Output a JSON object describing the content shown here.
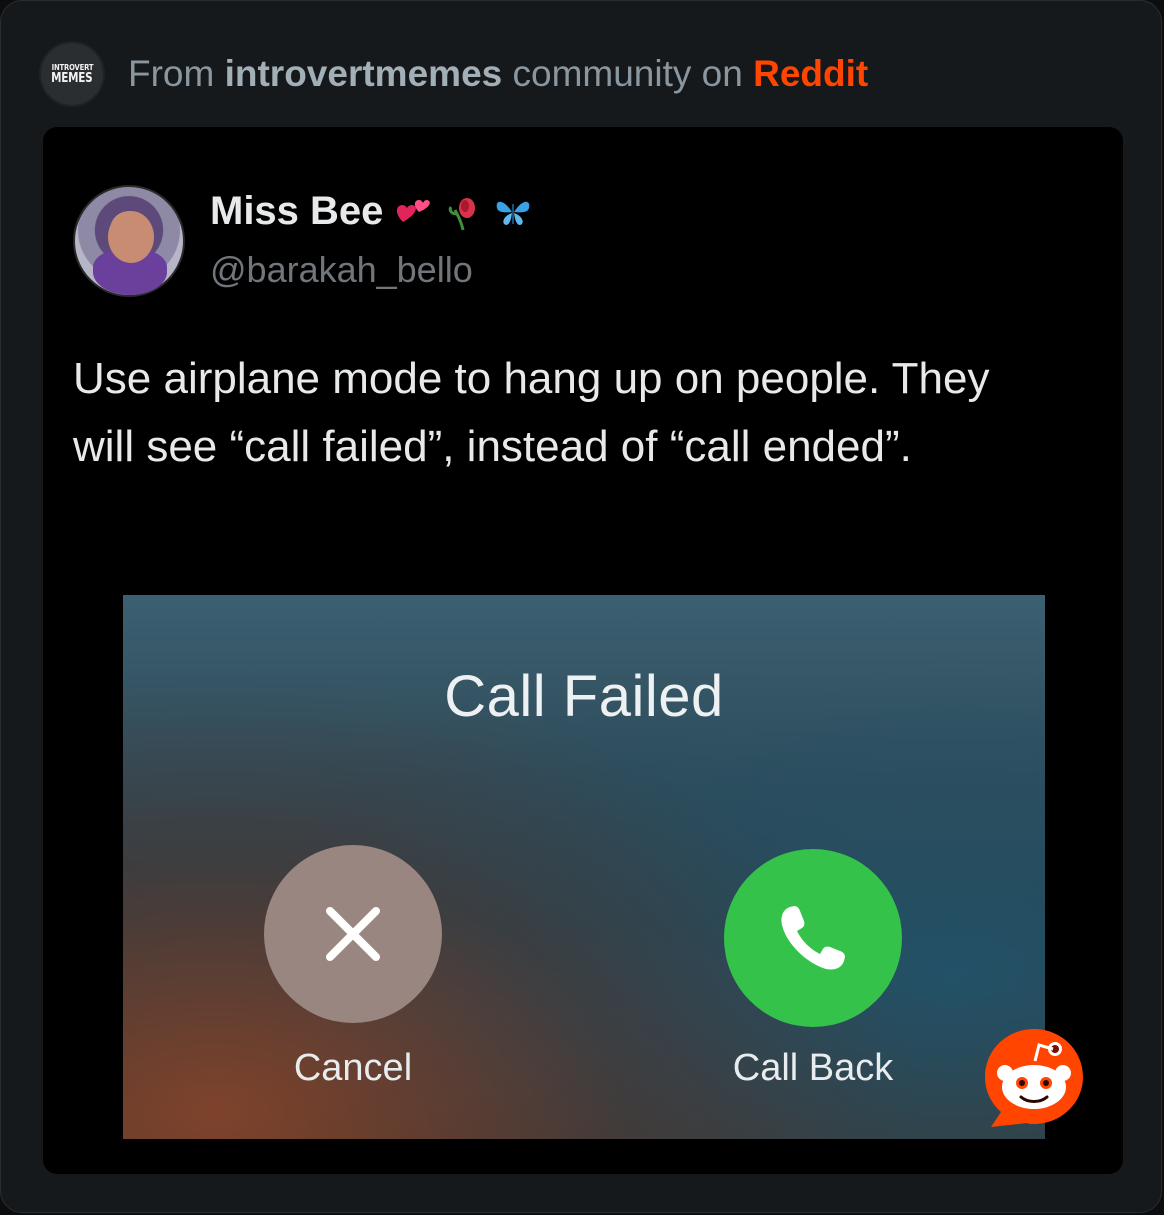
{
  "header": {
    "icon_line1": "INTROVERT",
    "icon_line2": "MEMES",
    "prefix": "From",
    "community": "introvertmemes",
    "middle": "community on",
    "platform": "Reddit"
  },
  "tweet": {
    "display_name": "Miss Bee",
    "emojis": [
      "hearts-emoji",
      "wilted-rose-emoji",
      "butterfly-emoji"
    ],
    "handle": "@barakah_bello",
    "text": "Use airplane mode to hang up on people. They will see “call failed”, instead of “call ended”."
  },
  "call_screen": {
    "title": "Call Failed",
    "cancel_label": "Cancel",
    "callback_label": "Call Back"
  },
  "colors": {
    "reddit": "#ff4500",
    "call_back": "#35c24a",
    "cancel": "#9a8680"
  }
}
